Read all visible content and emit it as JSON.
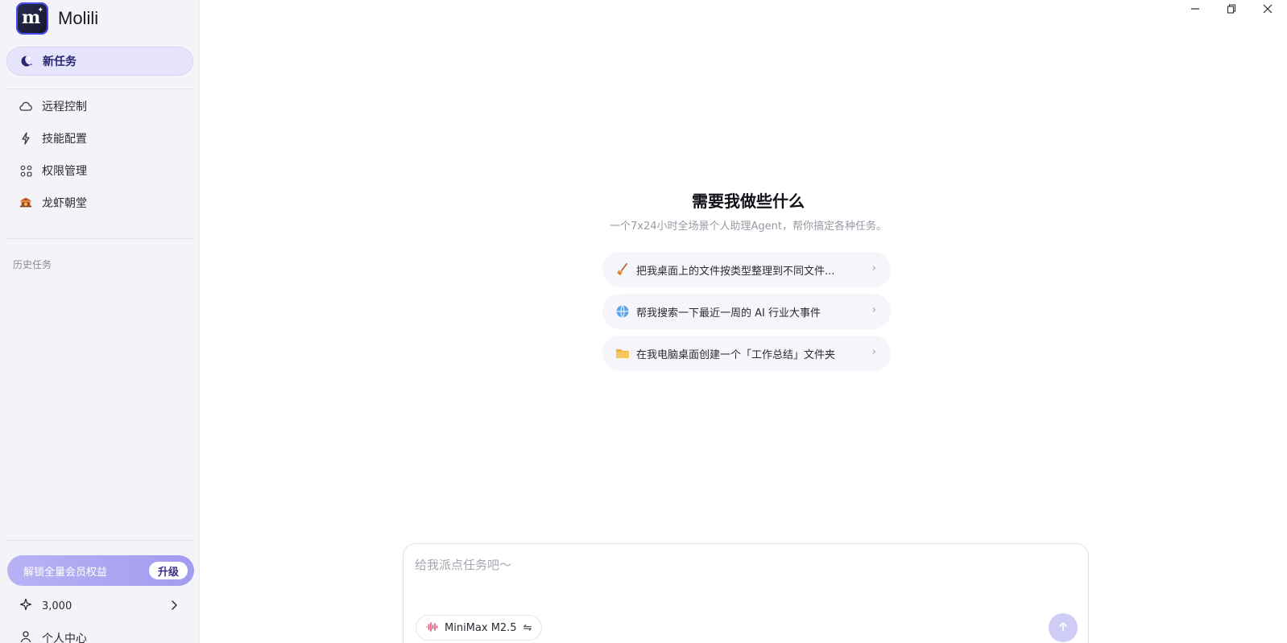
{
  "app": {
    "brand_name": "Molili",
    "logo_letter": "m"
  },
  "sidebar": {
    "new_task": "新任务",
    "items": [
      {
        "label": "远程控制",
        "icon": "cloud-icon"
      },
      {
        "label": "技能配置",
        "icon": "spark-icon"
      },
      {
        "label": "权限管理",
        "icon": "apps-icon"
      },
      {
        "label": "龙虾朝堂",
        "icon": "palace-icon"
      }
    ],
    "history_title": "历史任务",
    "upgrade_label": "解锁全量会员权益",
    "upgrade_button": "升级",
    "credits": "3,000",
    "profile_label": "个人中心"
  },
  "main": {
    "title": "需要我做些什么",
    "subtitle": "一个7x24小时全场景个人助理Agent，帮你搞定各种任务。",
    "suggestions": [
      {
        "label": "把我桌面上的文件按类型整理到不同文件...",
        "icon": "broom-icon"
      },
      {
        "label": "帮我搜索一下最近一周的 AI 行业大事件",
        "icon": "globe-icon"
      },
      {
        "label": "在我电脑桌面创建一个「工作总结」文件夹",
        "icon": "folder-icon"
      }
    ]
  },
  "composer": {
    "placeholder": "给我派点任务吧～",
    "value": "",
    "model_name": "MiniMax M2.5"
  },
  "colors": {
    "accent": "#6c63e8",
    "sidebar_bg": "#f4f3f8",
    "new_task_bg": "#e6e4fa",
    "upgrade_bg": "#aaa4f2",
    "send_bg": "#cfccf6"
  }
}
